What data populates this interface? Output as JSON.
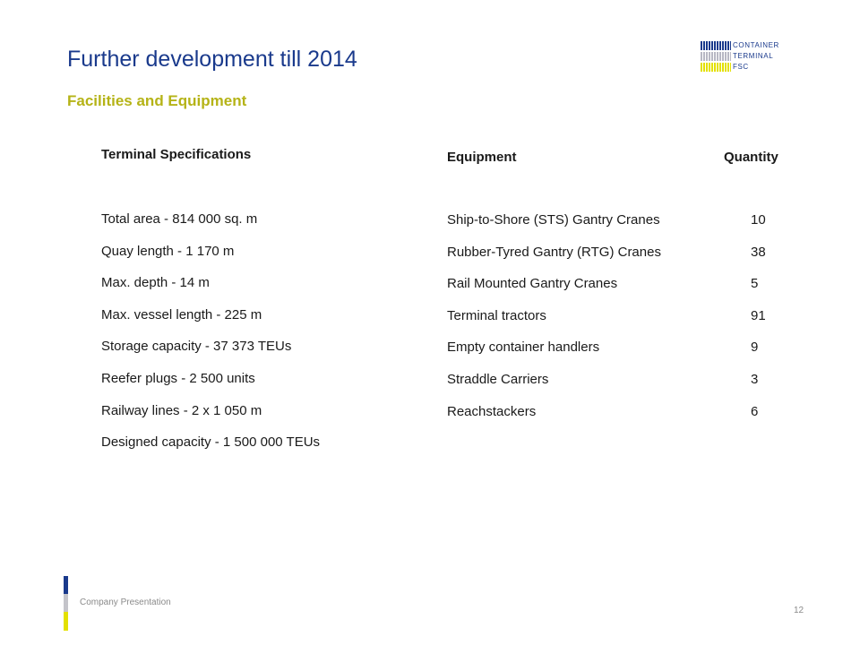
{
  "slide": {
    "title": "Further development till 2014",
    "subtitle": "Facilities and Equipment"
  },
  "logo": {
    "line1": "CONTAINER",
    "line2": "TERMINAL",
    "line3": "FSC",
    "colors": [
      "#1a3a8c",
      "#b8b8c4",
      "#e3e000"
    ]
  },
  "specs": {
    "heading": "Terminal Specifications",
    "items": [
      "Total area - 814 000 sq. m",
      "Quay length - 1 170 m",
      "Max. depth - 14 m",
      "Max. vessel length - 225 m",
      "Storage capacity - 37 373 TEUs",
      "Reefer plugs - 2 500 units",
      "Railway lines - 2 x 1 050 m",
      "Designed capacity - 1 500 000 TEUs"
    ]
  },
  "equipment": {
    "heading": "Equipment",
    "quantity_heading": "Quantity",
    "rows": [
      {
        "name": "Ship-to-Shore (STS) Gantry Cranes",
        "qty": "10"
      },
      {
        "name": "Rubber-Tyred Gantry (RTG) Cranes",
        "qty": "38"
      },
      {
        "name": "Rail Mounted Gantry Cranes",
        "qty": "5"
      },
      {
        "name": "Terminal tractors",
        "qty": "91"
      },
      {
        "name": "Empty container handlers",
        "qty": "9"
      },
      {
        "name": "Straddle Carriers",
        "qty": "3"
      },
      {
        "name": "Reachstackers",
        "qty": "6"
      }
    ]
  },
  "footer": {
    "label": "Company Presentation",
    "page_number": "12"
  },
  "colors": {
    "title": "#1a3a8c",
    "subtitle": "#b5b317",
    "accent_blue": "#1a3a8c",
    "accent_grey": "#c4c4ca",
    "accent_yellow": "#e3e000"
  }
}
